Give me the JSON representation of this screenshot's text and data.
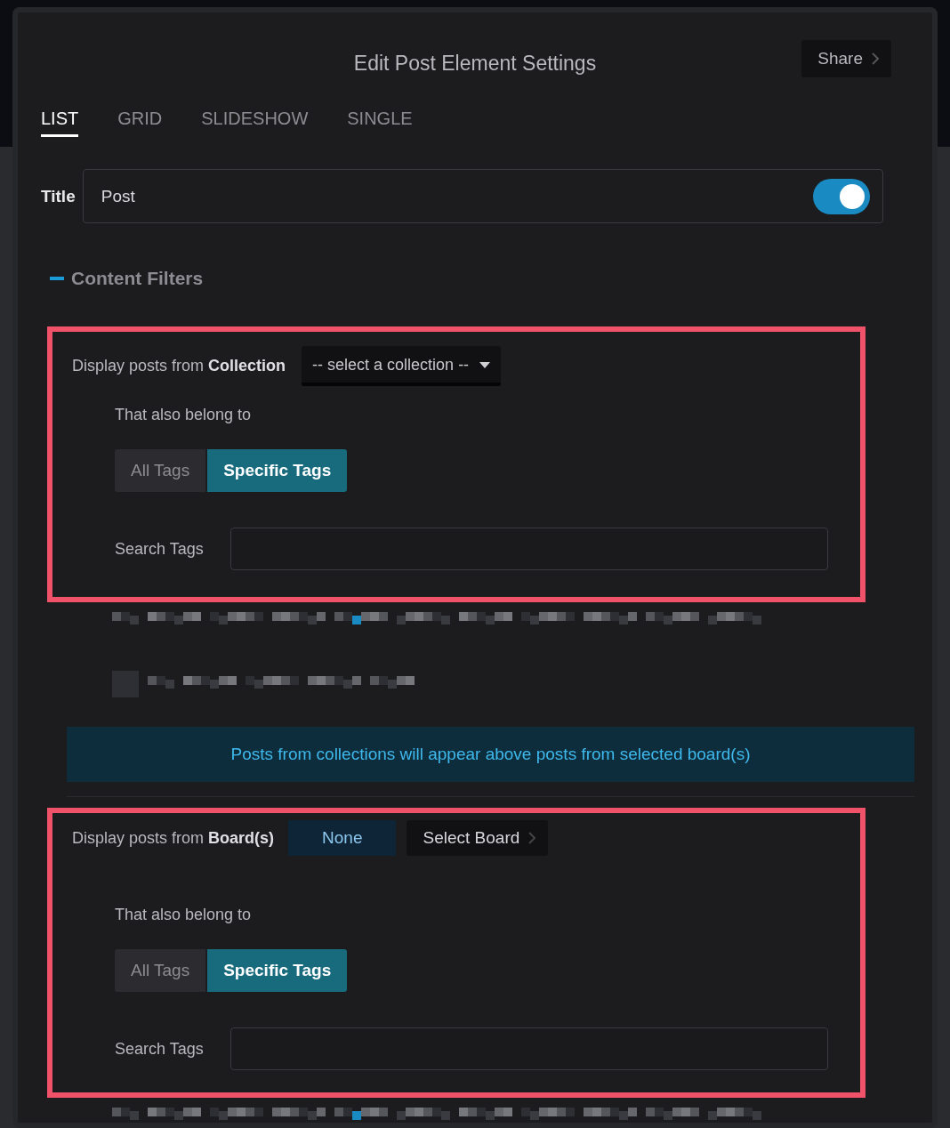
{
  "dialog": {
    "title": "Edit Post Element Settings",
    "share_button": "Share"
  },
  "tabs": [
    {
      "label": "LIST",
      "selected": true
    },
    {
      "label": "GRID",
      "selected": false
    },
    {
      "label": "SLIDESHOW",
      "selected": false
    },
    {
      "label": "SINGLE",
      "selected": false
    }
  ],
  "title_field": {
    "label": "Title",
    "value": "Post",
    "on": true
  },
  "section": {
    "label": "Content Filters",
    "expanded": true
  },
  "collection_filter": {
    "label": "Display posts from **Collection**",
    "dropdown": "-- select a collection --",
    "belong_label": "That also belong to",
    "tag_options": [
      {
        "label": "All Tags",
        "selected": false
      },
      {
        "label": "Specific Tags",
        "selected": true
      }
    ],
    "search_label": "Search Tags"
  },
  "redacted_after_collection": [
    {
      "kind": "line"
    },
    {
      "kind": "checkbox-line",
      "checked": false
    }
  ],
  "notice": "Posts from collections will appear above posts from selected board(s)",
  "board_filter": {
    "label": "Display posts from **Board(s)**",
    "none_button": "None",
    "select_button": "Select Board",
    "belong_label": "That also belong to",
    "tag_options": [
      {
        "label": "All Tags",
        "selected": false
      },
      {
        "label": "Specific Tags",
        "selected": true
      }
    ],
    "search_label": "Search Tags"
  },
  "redacted_after_board": [
    {
      "kind": "line"
    }
  ]
}
